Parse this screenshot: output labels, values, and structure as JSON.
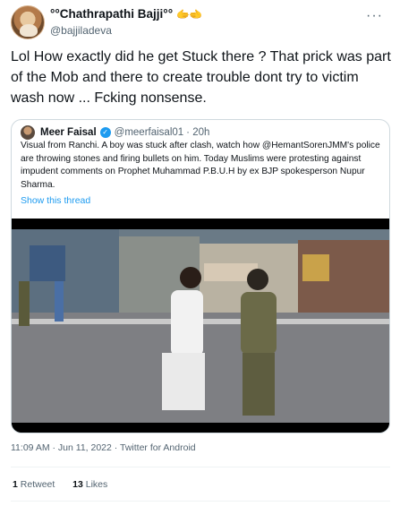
{
  "author": {
    "display_name": "°°Chathrapathi Bajji°°",
    "handle": "@bajjiladeva",
    "badge_emoji": "🫱🫲"
  },
  "tweet": {
    "text": "Lol How exactly did he get Stuck there ? That prick was part of the Mob and there to create trouble dont try to victim wash now ... Fcking nonsense.",
    "timestamp": "11:09 AM · Jun 11, 2022 · Twitter for Android",
    "retweets": "1",
    "retweets_label": "Retweet",
    "likes": "13",
    "likes_label": "Likes"
  },
  "quoted": {
    "display_name": "Meer Faisal",
    "handle": "@meerfaisal01",
    "age": "· 20h",
    "text": "Visual from Ranchi. A boy was stuck after clash, watch how @HemantSorenJMM's police are throwing stones and firing bullets on him. Today Muslims  were protesting against impudent comments on Prophet Muhammad P.B.U.H by ex BJP spokesperson Nupur Sharma.",
    "show_thread": "Show this thread"
  },
  "icons": {
    "more": "more-dots-icon",
    "verified": "verified-badge-icon"
  },
  "colors": {
    "link": "#1d9bf0",
    "muted": "#536471",
    "text": "#0f1419"
  }
}
